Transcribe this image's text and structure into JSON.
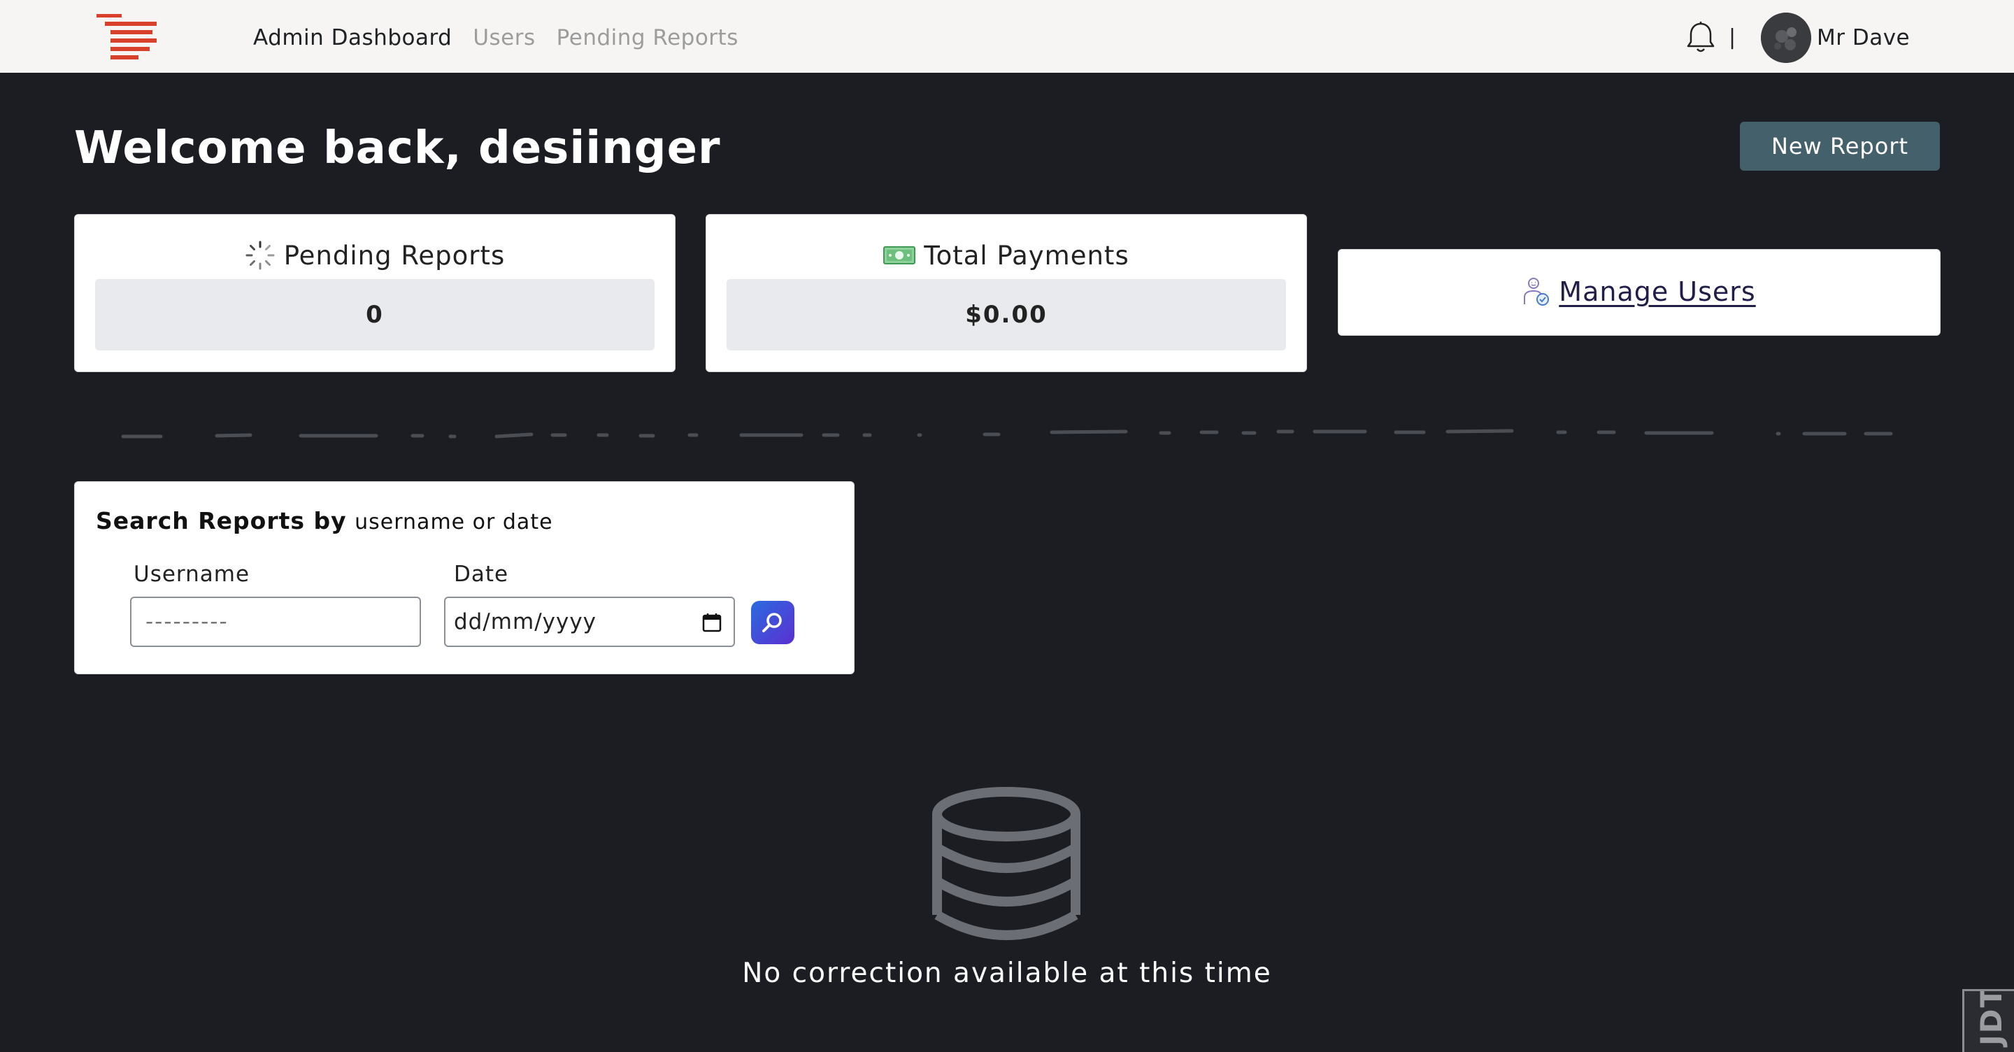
{
  "navbar": {
    "links": [
      {
        "label": "Admin Dashboard",
        "active": true
      },
      {
        "label": "Users",
        "active": false
      },
      {
        "label": "Pending Reports",
        "active": false
      }
    ],
    "separator": "|",
    "user_name": "Mr Dave",
    "brand_color": "#d9402b"
  },
  "header": {
    "welcome": "Welcome back, desiinger",
    "new_report_label": "New Report"
  },
  "stats": {
    "pending": {
      "label": "Pending Reports",
      "value": "0",
      "icon": "spinner-icon"
    },
    "payments": {
      "label": "Total Payments",
      "value": "$0.00",
      "icon": "money-icon"
    }
  },
  "manage_users": {
    "label": "Manage Users",
    "icon": "user-check-icon"
  },
  "search": {
    "title_bold": "Search Reports by",
    "title_rest": "username or date",
    "username_label": "Username",
    "username_placeholder": "---------",
    "date_label": "Date",
    "date_placeholder": "dd/mm/yyyy"
  },
  "empty_state": {
    "message": "No correction available at this time",
    "icon": "database-icon"
  },
  "corner_badge": {
    "text": "JDT"
  }
}
